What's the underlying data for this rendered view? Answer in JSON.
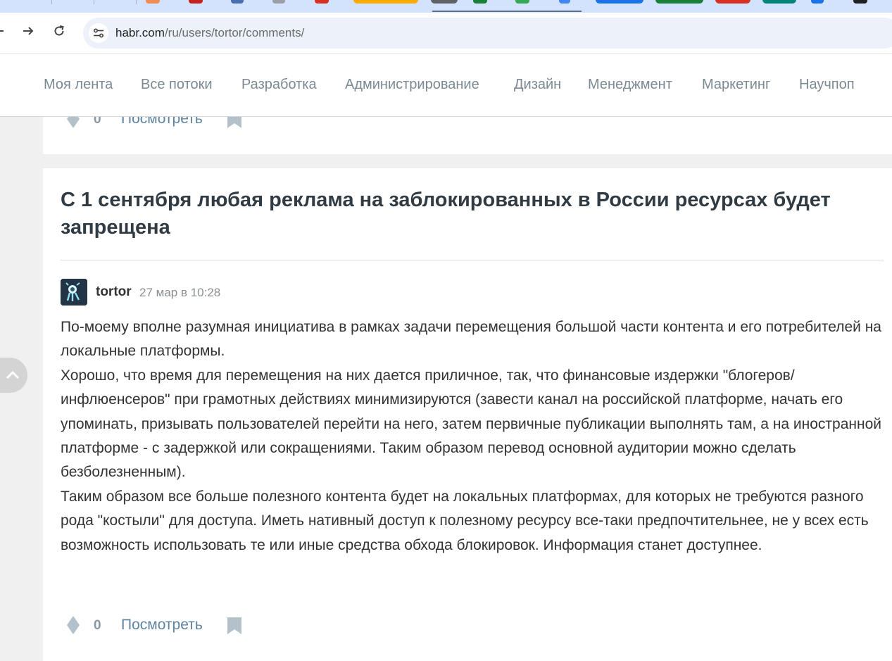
{
  "browser": {
    "url_host": "habr.com",
    "url_path": "/ru/users/tortor/comments/",
    "nav_icons": [
      "back-icon",
      "forward-icon",
      "reload-icon",
      "site-info-icon"
    ],
    "tab_colors": [
      "#f28b54",
      "#c5221f",
      "#4a6fb0",
      "#9aa0a6",
      "#d93025",
      "#f9ab00",
      "#5f6368",
      "#188038",
      "#34a853",
      "#4285f4",
      "#1a73e8",
      "#188038",
      "#d93025",
      "#008577",
      "#1a73e8",
      "#202124"
    ]
  },
  "site_nav": {
    "items": [
      "Моя лента",
      "Все потоки",
      "Разработка",
      "Администрирование",
      "Дизайн",
      "Менеджмент",
      "Маркетинг",
      "Научпоп"
    ]
  },
  "previous_comment_footer": {
    "score": "0",
    "view_label": "Посмотреть"
  },
  "comment": {
    "article_title": "С 1 сентября любая реклама на заблокированных в России ресурсах будет запрещена",
    "author": "tortor",
    "time": "27 мар в 10:28",
    "paragraphs": [
      "По-моему вполне разумная инициатива в рамках задачи перемещения большой части контента и его потребителей на локальные платформы.",
      "Хорошо, что время для перемещения на них дается приличное, так, что финансовые издержки \"блогеров/инфлюенсеров\" при грамотных действиях минимизируются (завести канал на российской платформе, начать его упоминать, призывать пользователей перейти на него, затем первичные публикации выполнять там, а на иностранной платформе - с задержкой или сокращениями. Таким образом перевод основной аудитории можно сделать безболезненным).",
      "Таким образом все больше полезного контента будет на локальных платформах, для которых не требуются разного рода \"костыли\" для доступа. Иметь нативный доступ к полезному ресурсу все-таки предпочтительнее, не у всех есть возможность использовать те или иные средства обхода блокировок. Информация станет доступнее."
    ],
    "score": "0",
    "view_label": "Посмотреть"
  },
  "colors": {
    "nav_text": "#7b8a92",
    "link": "#5e83a1",
    "title": "#303b44",
    "page_bg": "#f0f0f0"
  }
}
